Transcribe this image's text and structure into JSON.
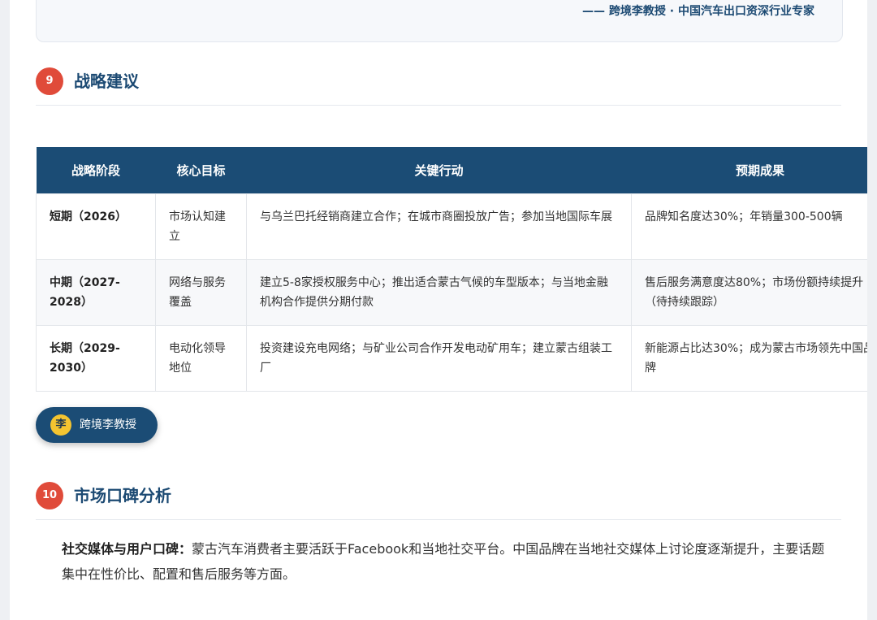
{
  "quote": {
    "author": "—— 跨境李教授 · 中国汽车出口资深行业专家"
  },
  "section9": {
    "number": "9",
    "title": "战略建议"
  },
  "strategy_table": {
    "headers": [
      "战略阶段",
      "核心目标",
      "关键行动",
      "预期成果"
    ],
    "rows": [
      {
        "stage": "短期（2026）",
        "goal": "市场认知建立",
        "actions": "与乌兰巴托经销商建立合作；在城市商圈投放广告；参加当地国际车展",
        "results": "品牌知名度达30%；年销量300-500辆"
      },
      {
        "stage": "中期（2027-2028）",
        "goal": "网络与服务覆盖",
        "actions": "建立5-8家授权服务中心；推出适合蒙古气候的车型版本；与当地金融机构合作提供分期付款",
        "results": "售后服务满意度达80%；市场份额持续提升（待持续跟踪）"
      },
      {
        "stage": "长期（2029-2030）",
        "goal": "电动化领导地位",
        "actions": "投资建设充电网络；与矿业公司合作开发电动矿用车；建立蒙古组装工厂",
        "results": "新能源占比达30%；成为蒙古市场领先中国品牌"
      }
    ]
  },
  "author_badge": {
    "avatar": "李",
    "label": "跨境李教授"
  },
  "section10": {
    "number": "10",
    "title": "市场口碑分析"
  },
  "paragraph": {
    "lead": "社交媒体与用户口碑：",
    "text": "蒙古汽车消费者主要活跃于Facebook和当地社交平台。中国品牌在当地社交媒体上讨论度逐渐提升，主要话题集中在性价比、配置和售后服务等方面。"
  }
}
